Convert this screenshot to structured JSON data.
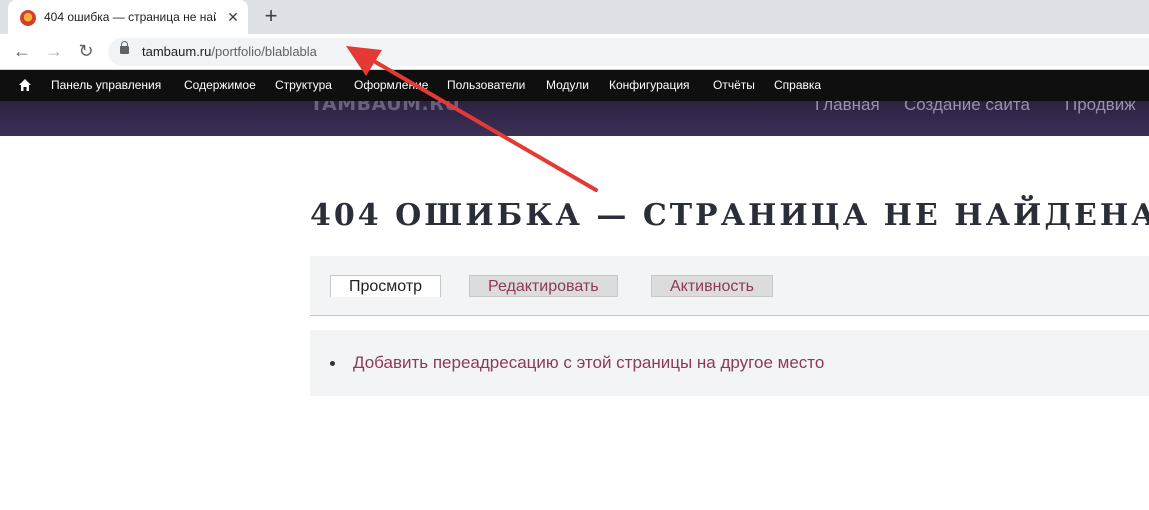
{
  "browser": {
    "tab_title": "404 ошибка — страница не най",
    "tab_close_glyph": "✕",
    "new_tab_glyph": "+",
    "back_glyph": "←",
    "forward_glyph": "→",
    "reload_glyph": "↻",
    "url_domain": "tambaum.ru",
    "url_path": "/portfolio/blablabla"
  },
  "admin_toolbar": {
    "home_icon": "home-icon",
    "items": [
      "Панель управления",
      "Содержимое",
      "Структура",
      "Оформление",
      "Пользователи",
      "Модули",
      "Конфигурация",
      "Отчёты",
      "Справка"
    ]
  },
  "site": {
    "logo": "TAMBAUM.RU",
    "nav": [
      "Главная",
      "Создание сайта",
      "Продвиж"
    ]
  },
  "page": {
    "title": "404 ОШИБКА — СТРАНИЦА НЕ НАЙДЕНА",
    "tabs": [
      "Просмотр",
      "Редактировать",
      "Активность"
    ],
    "active_tab": "Просмотр",
    "action_link": "Добавить переадресацию с этой страницы на другое место"
  },
  "colors": {
    "annotation_arrow": "#e53935",
    "link": "#8c3a55",
    "toolbar_bg": "#0f0f0f",
    "header_bg": "#3d2f58"
  }
}
